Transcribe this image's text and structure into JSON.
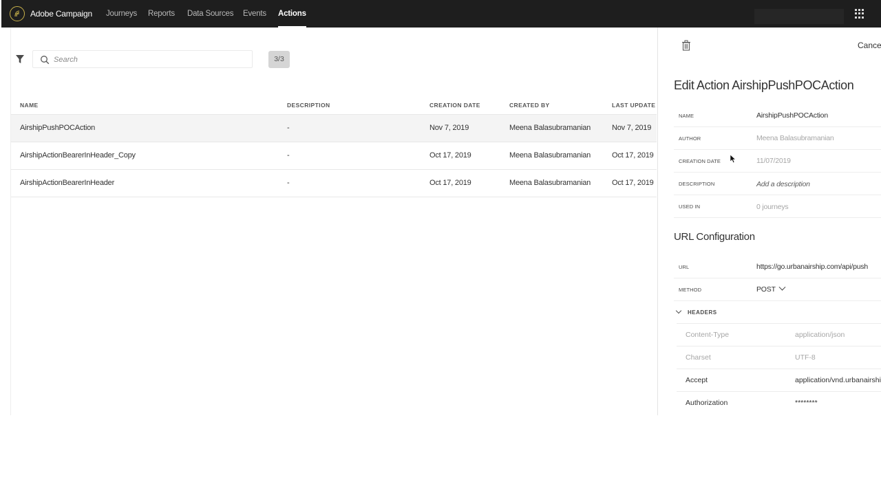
{
  "app": {
    "name": "Adobe Campaign"
  },
  "nav": {
    "items": [
      {
        "label": "Journeys"
      },
      {
        "label": "Reports"
      },
      {
        "label": "Data Sources"
      },
      {
        "label": "Events"
      },
      {
        "label": "Actions",
        "active": true
      }
    ]
  },
  "toolbar": {
    "search_placeholder": "Search",
    "count": "3/3"
  },
  "table": {
    "columns": [
      "NAME",
      "DESCRIPTION",
      "CREATION DATE",
      "CREATED BY",
      "LAST UPDATE"
    ],
    "rows": [
      {
        "name": "AirshipPushPOCAction",
        "description": "-",
        "creation_date": "Nov 7, 2019",
        "created_by": "Meena Balasubramanian",
        "last_update": "Nov 7, 2019",
        "selected": true
      },
      {
        "name": "AirshipActionBearerInHeader_Copy",
        "description": "-",
        "creation_date": "Oct 17, 2019",
        "created_by": "Meena Balasubramanian",
        "last_update": "Oct 17, 2019"
      },
      {
        "name": "AirshipActionBearerInHeader",
        "description": "-",
        "creation_date": "Oct 17, 2019",
        "created_by": "Meena Balasubramanian",
        "last_update": "Oct 17, 2019"
      }
    ]
  },
  "panel": {
    "cancel_label": "Cancel",
    "title": "Edit Action AirshipPushPOCAction",
    "fields": {
      "name_label": "NAME",
      "name_value": "AirshipPushPOCAction",
      "author_label": "AUTHOR",
      "author_value": "Meena Balasubramanian",
      "creation_date_label": "CREATION DATE",
      "creation_date_value": "11/07/2019",
      "description_label": "DESCRIPTION",
      "description_placeholder": "Add a description",
      "used_in_label": "USED IN",
      "used_in_value": "0 journeys"
    },
    "url_config": {
      "title": "URL Configuration",
      "url_label": "URL",
      "url_value": "https://go.urbanairship.com/api/push",
      "method_label": "METHOD",
      "method_value": "POST",
      "headers_label": "HEADERS",
      "headers": [
        {
          "key": "Content-Type",
          "value": "application/json",
          "readonly": true
        },
        {
          "key": "Charset",
          "value": "UTF-8",
          "readonly": true
        },
        {
          "key": "Accept",
          "value": "application/vnd.urbanairship",
          "readonly": false
        },
        {
          "key": "Authorization",
          "value": "********",
          "readonly": false
        }
      ]
    }
  },
  "colors": {
    "topbar": "#1e1e1e",
    "logo": "#c9b24a",
    "selected_row": "#f4f4f4"
  },
  "icons": [
    "logo-icon",
    "app-grid-icon",
    "filter-icon",
    "search-icon",
    "trash-icon",
    "chevron-down-icon",
    "mouse-cursor-icon"
  ]
}
